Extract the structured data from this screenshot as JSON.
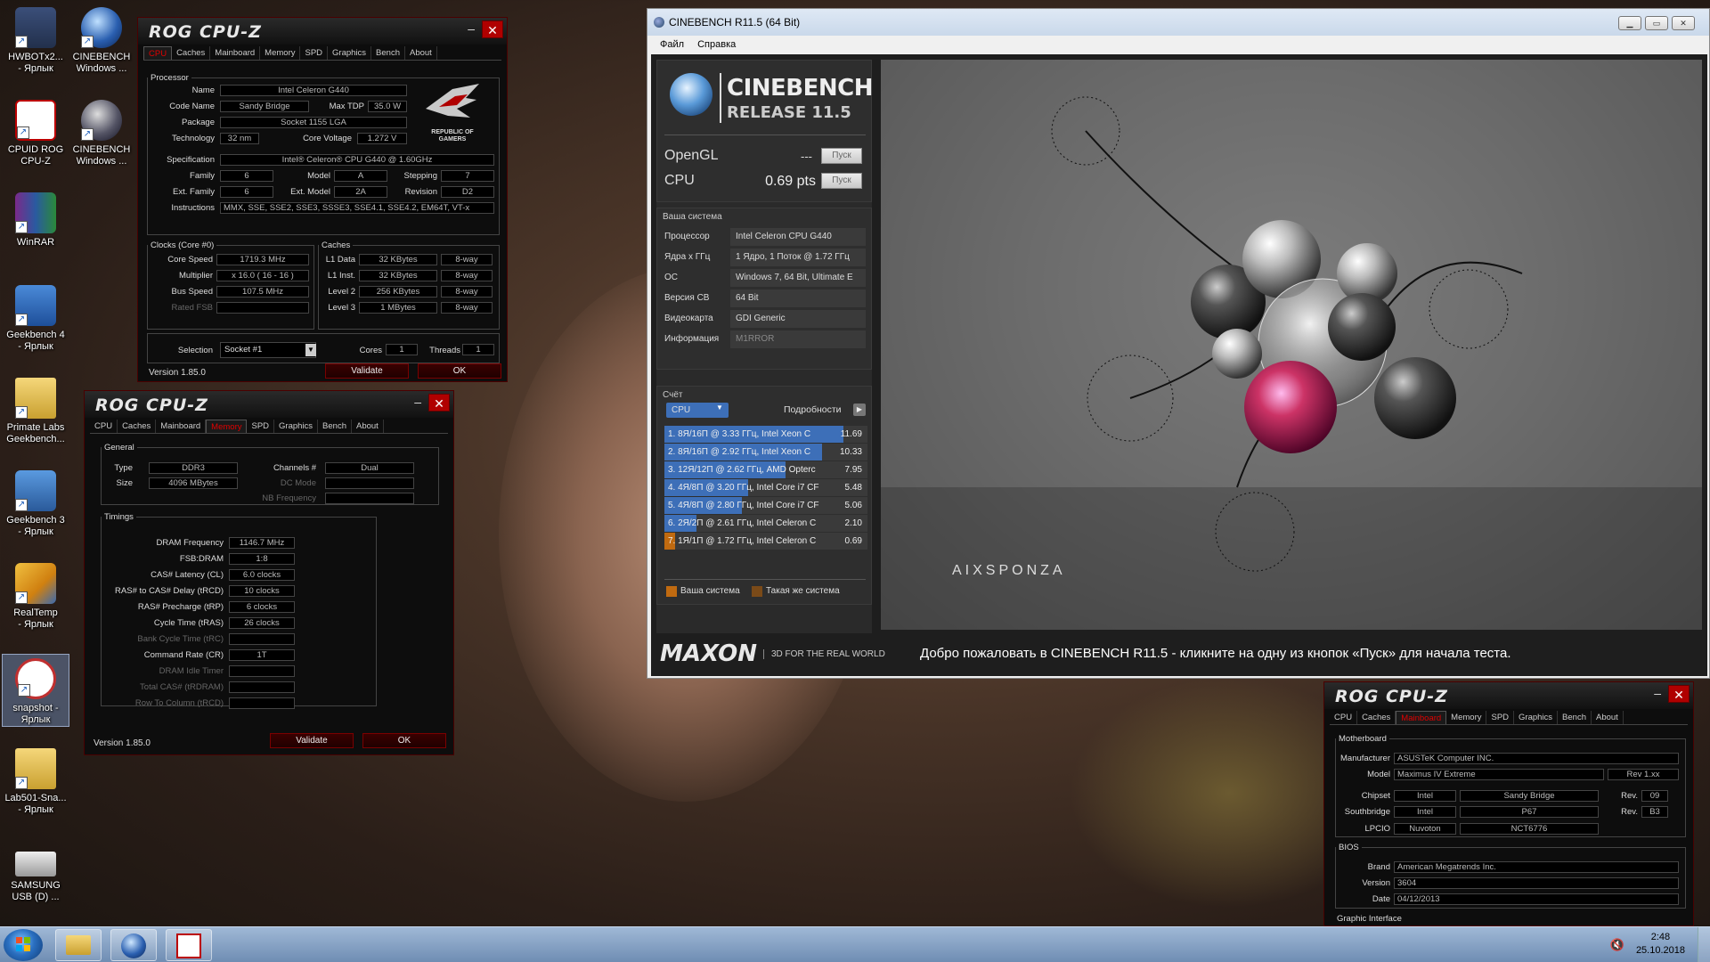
{
  "desktop": {
    "icons": [
      {
        "label": "HWBOTx2...\n- Ярлык"
      },
      {
        "label": "CINEBENCH\nWindows ..."
      },
      {
        "label": "CPUID ROG\nCPU-Z"
      },
      {
        "label": "CINEBENCH\nWindows ..."
      },
      {
        "label": "WinRAR"
      },
      {
        "label": "Geekbench 4\n- Ярлык"
      },
      {
        "label": "Primate Labs\nGeekbench..."
      },
      {
        "label": "Geekbench 3\n- Ярлык"
      },
      {
        "label": "RealTemp\n- Ярлык"
      },
      {
        "label": "snapshot -\nЯрлык"
      },
      {
        "label": "Lab501-Sna...\n- Ярлык"
      },
      {
        "label": "SAMSUNG\nUSB (D) ..."
      }
    ]
  },
  "cpuz1": {
    "title": "ROG CPU-Z",
    "tabs": [
      "CPU",
      "Caches",
      "Mainboard",
      "Memory",
      "SPD",
      "Graphics",
      "Bench",
      "About"
    ],
    "active_tab": "CPU",
    "processor_legend": "Processor",
    "name_label": "Name",
    "name": "Intel Celeron G440",
    "codename_label": "Code Name",
    "codename": "Sandy Bridge",
    "maxtdp_label": "Max TDP",
    "maxtdp": "35.0 W",
    "package_label": "Package",
    "package": "Socket 1155 LGA",
    "technology_label": "Technology",
    "technology": "32 nm",
    "corevoltage_label": "Core Voltage",
    "corevoltage": "1.272 V",
    "spec_label": "Specification",
    "spec": "Intel® Celeron® CPU G440 @ 1.60GHz",
    "family_label": "Family",
    "family": "6",
    "model_label": "Model",
    "model": "A",
    "stepping_label": "Stepping",
    "stepping": "7",
    "extfamily_label": "Ext. Family",
    "extfamily": "6",
    "extmodel_label": "Ext. Model",
    "extmodel": "2A",
    "revision_label": "Revision",
    "revision": "D2",
    "instructions_label": "Instructions",
    "instructions": "MMX, SSE, SSE2, SSE3, SSSE3, SSE4.1, SSE4.2, EM64T, VT-x",
    "clocks_legend": "Clocks (Core #0)",
    "corespeed_label": "Core Speed",
    "corespeed": "1719.3 MHz",
    "multiplier_label": "Multiplier",
    "multiplier": "x 16.0 ( 16 - 16 )",
    "busspeed_label": "Bus Speed",
    "busspeed": "107.5 MHz",
    "ratedfsb_label": "Rated FSB",
    "ratedfsb": "",
    "caches_legend": "Caches",
    "l1data_label": "L1 Data",
    "l1data": "32 KBytes",
    "l1data_way": "8-way",
    "l1inst_label": "L1 Inst.",
    "l1inst": "32 KBytes",
    "l1inst_way": "8-way",
    "level2_label": "Level 2",
    "level2": "256 KBytes",
    "level2_way": "8-way",
    "level3_label": "Level 3",
    "level3": "1 MBytes",
    "level3_way": "8-way",
    "selection_label": "Selection",
    "selection": "Socket #1",
    "cores_label": "Cores",
    "cores": "1",
    "threads_label": "Threads",
    "threads": "1",
    "version": "Version 1.85.0",
    "validate": "Validate",
    "ok": "OK",
    "emblem_text": "REPUBLIC OF\nGAMERS"
  },
  "cpuz2": {
    "title": "ROG CPU-Z",
    "tabs": [
      "CPU",
      "Caches",
      "Mainboard",
      "Memory",
      "SPD",
      "Graphics",
      "Bench",
      "About"
    ],
    "active_tab": "Memory",
    "general_legend": "General",
    "type_label": "Type",
    "type": "DDR3",
    "size_label": "Size",
    "size": "4096 MBytes",
    "channels_label": "Channels #",
    "channels": "Dual",
    "dcmode_label": "DC Mode",
    "dcmode": "",
    "nbfreq_label": "NB Frequency",
    "nbfreq": "",
    "timings_legend": "Timings",
    "timings": [
      {
        "label": "DRAM Frequency",
        "value": "1146.7 MHz",
        "dim": false
      },
      {
        "label": "FSB:DRAM",
        "value": "1:8",
        "dim": false
      },
      {
        "label": "CAS# Latency (CL)",
        "value": "6.0 clocks",
        "dim": false
      },
      {
        "label": "RAS# to CAS# Delay (tRCD)",
        "value": "10 clocks",
        "dim": false
      },
      {
        "label": "RAS# Precharge (tRP)",
        "value": "6 clocks",
        "dim": false
      },
      {
        "label": "Cycle Time (tRAS)",
        "value": "26 clocks",
        "dim": false
      },
      {
        "label": "Bank Cycle Time (tRC)",
        "value": "",
        "dim": true
      },
      {
        "label": "Command Rate (CR)",
        "value": "1T",
        "dim": false
      },
      {
        "label": "DRAM Idle Timer",
        "value": "",
        "dim": true
      },
      {
        "label": "Total CAS# (tRDRAM)",
        "value": "",
        "dim": true
      },
      {
        "label": "Row To Column (tRCD)",
        "value": "",
        "dim": true
      }
    ],
    "version": "Version 1.85.0",
    "validate": "Validate",
    "ok": "OK"
  },
  "cpuz3": {
    "title": "ROG CPU-Z",
    "tabs": [
      "CPU",
      "Caches",
      "Mainboard",
      "Memory",
      "SPD",
      "Graphics",
      "Bench",
      "About"
    ],
    "active_tab": "Mainboard",
    "motherboard_legend": "Motherboard",
    "manufacturer_label": "Manufacturer",
    "manufacturer": "ASUSTeK Computer INC.",
    "model_label": "Model",
    "model": "Maximus IV Extreme",
    "model_rev": "Rev 1.xx",
    "chipset_label": "Chipset",
    "chipset_vendor": "Intel",
    "chipset": "Sandy Bridge",
    "chipset_rev_label": "Rev.",
    "chipset_rev": "09",
    "southbridge_label": "Southbridge",
    "sb_vendor": "Intel",
    "sb": "P67",
    "sb_rev_label": "Rev.",
    "sb_rev": "B3",
    "lpcio_label": "LPCIO",
    "lpcio_vendor": "Nuvoton",
    "lpcio": "NCT6776",
    "bios_legend": "BIOS",
    "brand_label": "Brand",
    "brand": "American Megatrends Inc.",
    "biosver_label": "Version",
    "biosver": "3604",
    "date_label": "Date",
    "date": "04/12/2013",
    "graphic_legend": "Graphic Interface"
  },
  "cinebench": {
    "title": "CINEBENCH R11.5 (64 Bit)",
    "menu": [
      "Файл",
      "Справка"
    ],
    "logo_top": "CINEBENCH",
    "logo_bottom": "RELEASE 11.5",
    "opengl_label": "OpenGL",
    "opengl_value": "---",
    "cpu_label": "CPU",
    "cpu_value": "0.69 pts",
    "run_label": "Пуск",
    "system_title": "Ваша система",
    "system": [
      {
        "label": "Процессор",
        "value": "Intel Celeron CPU G440"
      },
      {
        "label": "Ядра x ГГц",
        "value": "1 Ядро, 1 Поток @ 1.72 ГГц"
      },
      {
        "label": "ОС",
        "value": "Windows 7, 64 Bit, Ultimate E"
      },
      {
        "label": "Версия CB",
        "value": "64 Bit"
      },
      {
        "label": "Видеокарта",
        "value": "GDI Generic"
      },
      {
        "label": "Информация",
        "value": "M1RROR"
      }
    ],
    "score_title": "Счёт",
    "score_select": "CPU",
    "details_label": "Подробности",
    "ranking": [
      {
        "text": "1. 8Я/16П @ 3.33 ГГц, Intel Xeon C",
        "score": "11.69",
        "value": 11.69,
        "mine": false
      },
      {
        "text": "2. 8Я/16П @ 2.92 ГГц, Intel Xeon C",
        "score": "10.33",
        "value": 10.33,
        "mine": false
      },
      {
        "text": "3. 12Я/12П @ 2.62 ГГц, AMD Opterc",
        "score": "7.95",
        "value": 7.95,
        "mine": false
      },
      {
        "text": "4. 4Я/8П @ 3.20 ГГц, Intel Core i7 CF",
        "score": "5.48",
        "value": 5.48,
        "mine": false
      },
      {
        "text": "5. 4Я/8П @ 2.80 ГГц, Intel Core i7 CF",
        "score": "5.06",
        "value": 5.06,
        "mine": false
      },
      {
        "text": "6. 2Я/2П @ 2.61 ГГц, Intel Celeron C",
        "score": "2.10",
        "value": 2.1,
        "mine": false
      },
      {
        "text": "7. 1Я/1П @ 1.72 ГГц, Intel Celeron C",
        "score": "0.69",
        "value": 0.69,
        "mine": true
      }
    ],
    "legend_mine": "Ваша система",
    "legend_same": "Такая же система",
    "maxon": "MAXON",
    "maxon_tag": "3D FOR THE REAL WORLD",
    "welcome": "Добро пожаловать в CINEBENCH R11.5 - кликните на одну из кнопок «Пуск» для начала теста.",
    "render_brand": "AIXSPONZA",
    "colors": {
      "bar": "#3d6fb8",
      "mine": "#c06a10"
    }
  },
  "taskbar": {
    "time": "2:48",
    "date": "25.10.2018"
  }
}
